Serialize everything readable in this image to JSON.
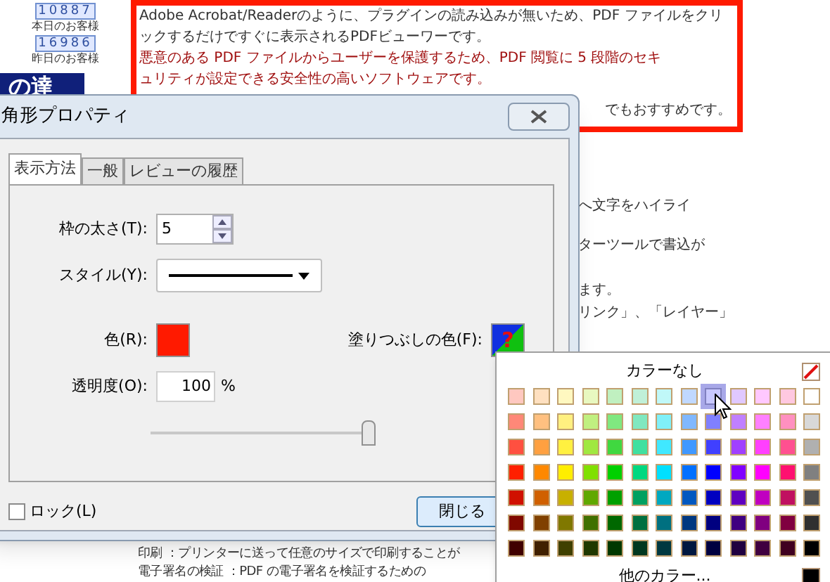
{
  "sidebar": {
    "counters": [
      {
        "digits": "10887",
        "label": "本日のお客様"
      },
      {
        "digits": "16986",
        "label": "昨日のお客様"
      }
    ],
    "banner": "の達"
  },
  "article": {
    "highlight_lines": [
      {
        "text": "Adobe Acrobat/Readerのように、プラグインの読み込みが無いため、PDF ファイルをクリ",
        "kind": "normal"
      },
      {
        "text": "ックするだけですぐに表示されるPDFビューワーです。",
        "kind": "normal"
      },
      {
        "text": "悪意のある PDF ファイルからユーザーを保護するため、PDF 閲覧に 5 段階のセキ",
        "kind": "warning"
      },
      {
        "text": "ュリティが設定できる安全性の高いソフトウェアです。",
        "kind": "warning"
      }
    ],
    "highlight_tail": "でもおすすめです。",
    "fragments": [
      "へ文字をハイライ",
      "ターツールで書込が",
      "ます。",
      "リンク」、「レイヤー」"
    ],
    "bottom_lines": [
      "印刷 ：プリンターに送って任意のサイズで印刷することが",
      "電子署名の検証 ：PDF の電子署名を検証するための"
    ]
  },
  "dialog": {
    "title": "角形プロパティ",
    "tabs": [
      {
        "label": "表示方法",
        "selected": true
      },
      {
        "label": "一般",
        "selected": false
      },
      {
        "label": "レビューの履歴",
        "selected": false
      }
    ],
    "thickness": {
      "label": "枠の太さ(T):",
      "value": "5"
    },
    "style": {
      "label": "スタイル(Y):"
    },
    "color": {
      "label": "色(R):",
      "color": "#ff1a00"
    },
    "fill": {
      "label": "塗りつぶしの色(F):",
      "symbol": "?"
    },
    "opacity": {
      "label": "透明度(O):",
      "value": "100",
      "unit": "%",
      "level": 1
    },
    "lock": {
      "label": "ロック(L)",
      "checked": false
    },
    "close_button": "閉じる"
  },
  "palette": {
    "title": "カラーなし",
    "more": "他のカラー...",
    "rows": [
      [
        {
          "color": "#ffc8c0",
          "selected": false
        },
        {
          "color": "#ffe0c0",
          "selected": false
        },
        {
          "color": "#fff8c0",
          "selected": false
        },
        {
          "color": "#e8f8c0",
          "selected": false
        },
        {
          "color": "#c0f0c0",
          "selected": false
        },
        {
          "color": "#c0f0d8",
          "selected": false
        },
        {
          "color": "#c0f8f8",
          "selected": false
        },
        {
          "color": "#c0d8ff",
          "selected": false
        },
        {
          "color": "#c8c8ff",
          "selected": true
        },
        {
          "color": "#e0c8ff",
          "selected": false
        },
        {
          "color": "#ffc8ff",
          "selected": false
        },
        {
          "color": "#ffc8e0",
          "selected": false
        },
        {
          "color": "#ffffff",
          "selected": false
        }
      ],
      [
        {
          "color": "#ff8878",
          "selected": false
        },
        {
          "color": "#ffc080",
          "selected": false
        },
        {
          "color": "#fff080",
          "selected": false
        },
        {
          "color": "#c0f080",
          "selected": false
        },
        {
          "color": "#80e880",
          "selected": false
        },
        {
          "color": "#80e8c0",
          "selected": false
        },
        {
          "color": "#80f0f8",
          "selected": false
        },
        {
          "color": "#80b8ff",
          "selected": false
        },
        {
          "color": "#8080ff",
          "selected": false
        },
        {
          "color": "#c080ff",
          "selected": false
        },
        {
          "color": "#ff80ff",
          "selected": false
        },
        {
          "color": "#ff90c0",
          "selected": false
        },
        {
          "color": "#d8d8d8",
          "selected": false
        }
      ],
      [
        {
          "color": "#ff5040",
          "selected": false
        },
        {
          "color": "#ffa040",
          "selected": false
        },
        {
          "color": "#fff040",
          "selected": false
        },
        {
          "color": "#a0e840",
          "selected": false
        },
        {
          "color": "#40d840",
          "selected": false
        },
        {
          "color": "#40e0a0",
          "selected": false
        },
        {
          "color": "#40e8ff",
          "selected": false
        },
        {
          "color": "#4098ff",
          "selected": false
        },
        {
          "color": "#4040ff",
          "selected": false
        },
        {
          "color": "#a040ff",
          "selected": false
        },
        {
          "color": "#ff40ff",
          "selected": false
        },
        {
          "color": "#ff5090",
          "selected": false
        },
        {
          "color": "#b0b0b0",
          "selected": false
        }
      ],
      [
        {
          "color": "#ff2000",
          "selected": false
        },
        {
          "color": "#ff8800",
          "selected": false
        },
        {
          "color": "#ffee00",
          "selected": false
        },
        {
          "color": "#80e000",
          "selected": false
        },
        {
          "color": "#00d000",
          "selected": false
        },
        {
          "color": "#00d880",
          "selected": false
        },
        {
          "color": "#00e0ff",
          "selected": false
        },
        {
          "color": "#0070ff",
          "selected": false
        },
        {
          "color": "#0000ff",
          "selected": false
        },
        {
          "color": "#8000ff",
          "selected": false
        },
        {
          "color": "#ff00ff",
          "selected": false
        },
        {
          "color": "#ff1070",
          "selected": false
        },
        {
          "color": "#808080",
          "selected": false
        }
      ],
      [
        {
          "color": "#d01000",
          "selected": false
        },
        {
          "color": "#d06000",
          "selected": false
        },
        {
          "color": "#c8b000",
          "selected": false
        },
        {
          "color": "#60a800",
          "selected": false
        },
        {
          "color": "#00a000",
          "selected": false
        },
        {
          "color": "#00a060",
          "selected": false
        },
        {
          "color": "#00a8c0",
          "selected": false
        },
        {
          "color": "#0058c0",
          "selected": false
        },
        {
          "color": "#0000c0",
          "selected": false
        },
        {
          "color": "#6000c0",
          "selected": false
        },
        {
          "color": "#c000c0",
          "selected": false
        },
        {
          "color": "#c01060",
          "selected": false
        },
        {
          "color": "#505050",
          "selected": false
        }
      ],
      [
        {
          "color": "#800800",
          "selected": false
        },
        {
          "color": "#804000",
          "selected": false
        },
        {
          "color": "#807800",
          "selected": false
        },
        {
          "color": "#407000",
          "selected": false
        },
        {
          "color": "#006800",
          "selected": false
        },
        {
          "color": "#007040",
          "selected": false
        },
        {
          "color": "#007080",
          "selected": false
        },
        {
          "color": "#003880",
          "selected": false
        },
        {
          "color": "#000080",
          "selected": false
        },
        {
          "color": "#400080",
          "selected": false
        },
        {
          "color": "#800080",
          "selected": false
        },
        {
          "color": "#800040",
          "selected": false
        },
        {
          "color": "#303030",
          "selected": false
        }
      ],
      [
        {
          "color": "#400000",
          "selected": false
        },
        {
          "color": "#402000",
          "selected": false
        },
        {
          "color": "#404000",
          "selected": false
        },
        {
          "color": "#203800",
          "selected": false
        },
        {
          "color": "#003800",
          "selected": false
        },
        {
          "color": "#003820",
          "selected": false
        },
        {
          "color": "#003840",
          "selected": false
        },
        {
          "color": "#001840",
          "selected": false
        },
        {
          "color": "#000040",
          "selected": false
        },
        {
          "color": "#200040",
          "selected": false
        },
        {
          "color": "#400040",
          "selected": false
        },
        {
          "color": "#400020",
          "selected": false
        },
        {
          "color": "#000000",
          "selected": false
        }
      ]
    ]
  }
}
